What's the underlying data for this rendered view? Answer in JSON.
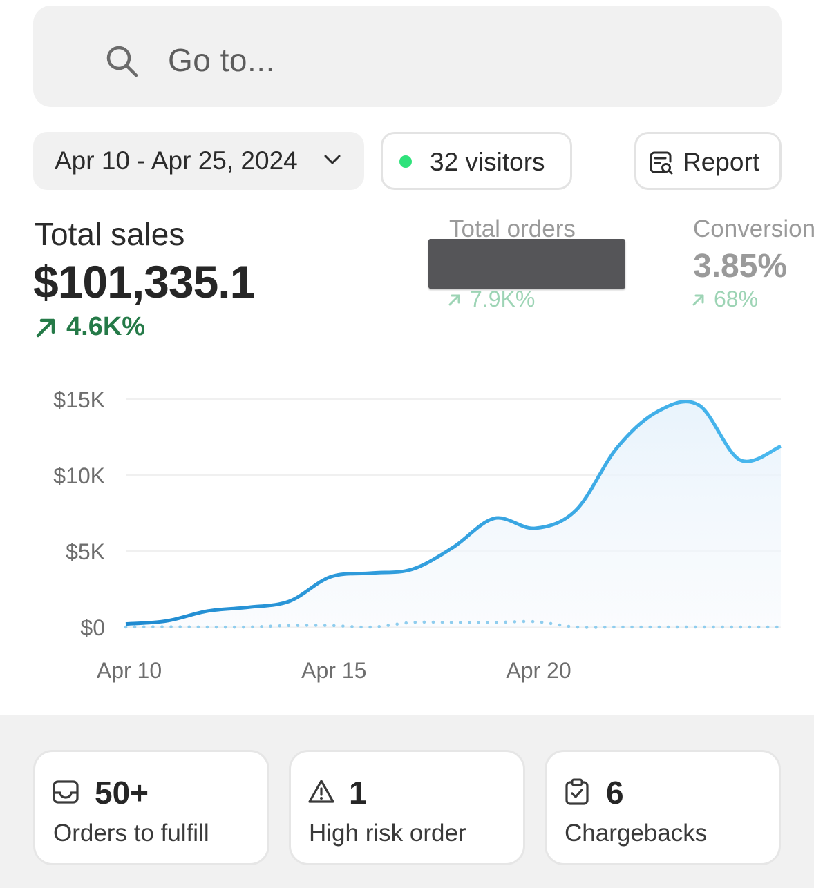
{
  "search": {
    "placeholder": "Go to..."
  },
  "toolbar": {
    "date_range": "Apr 10 - Apr 25, 2024",
    "visitors_label": "32 visitors",
    "report_label": "Report"
  },
  "metrics": {
    "total_sales": {
      "title": "Total sales",
      "value": "$101,335.1",
      "change": "4.6K%"
    },
    "total_orders": {
      "title": "Total orders",
      "change": "7.9K%"
    },
    "conversion": {
      "title": "Conversion",
      "value": "3.85%",
      "change": "68%"
    }
  },
  "colors": {
    "accent_line": "#2f9fdc",
    "positive": "#257a48",
    "live_dot": "#2fe27b"
  },
  "chart_data": {
    "type": "line",
    "title": "",
    "xlabel": "",
    "ylabel": "",
    "ylim": [
      0,
      15000
    ],
    "yticks": [
      "$15K",
      "$10K",
      "$5K",
      "$0"
    ],
    "ytick_values": [
      15000,
      10000,
      5000,
      0
    ],
    "x_tick_labels": [
      "Apr 10",
      "Apr 15",
      "Apr 20"
    ],
    "x_tick_index": [
      0,
      5,
      10
    ],
    "x_days": 16,
    "grid": true,
    "series": [
      {
        "style": "solid",
        "values": [
          200,
          400,
          1050,
          1300,
          1700,
          3300,
          3550,
          3800,
          5250,
          7150,
          6500,
          7700,
          11800,
          14200,
          14600,
          11000,
          11900
        ]
      },
      {
        "style": "dotted",
        "values": [
          0,
          20,
          0,
          0,
          100,
          100,
          0,
          300,
          300,
          300,
          350,
          0,
          0,
          0,
          0,
          0,
          0
        ]
      }
    ]
  },
  "cards": [
    {
      "icon": "inbox-icon",
      "value": "50+",
      "label": "Orders to fulfill"
    },
    {
      "icon": "warning-icon",
      "value": "1",
      "label": "High risk order"
    },
    {
      "icon": "clipboard-check-icon",
      "value": "6",
      "label": "Chargebacks"
    }
  ]
}
